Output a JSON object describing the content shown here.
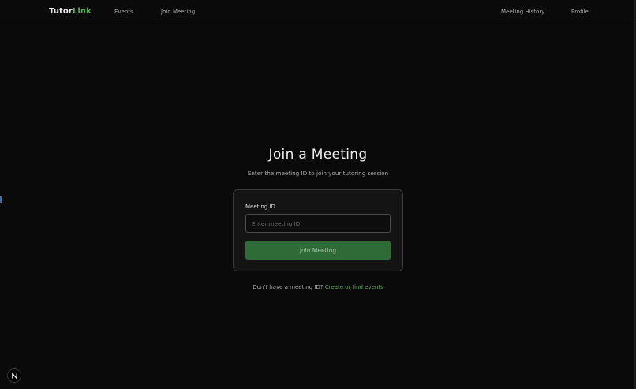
{
  "nav": {
    "logo_part1": "Tutor",
    "logo_part2": "Link",
    "links_left": [
      "Events",
      "Join Meeting"
    ],
    "links_right": [
      "Meeting History",
      "Profile"
    ]
  },
  "main": {
    "heading": "Join a Meeting",
    "subheading": "Enter the meeting ID to join your tutoring session"
  },
  "form": {
    "label": "Meeting ID",
    "input_placeholder": "Enter meeting ID",
    "input_value": "",
    "button_label": "Join Meeting"
  },
  "footer": {
    "prompt": "Don't have a meeting ID? ",
    "link_label": "Create or find events"
  },
  "badge": {
    "letter": "N"
  },
  "colors": {
    "accent": "#4caf50",
    "button_bg": "#2f6b36",
    "background": "#0a0a0a"
  }
}
